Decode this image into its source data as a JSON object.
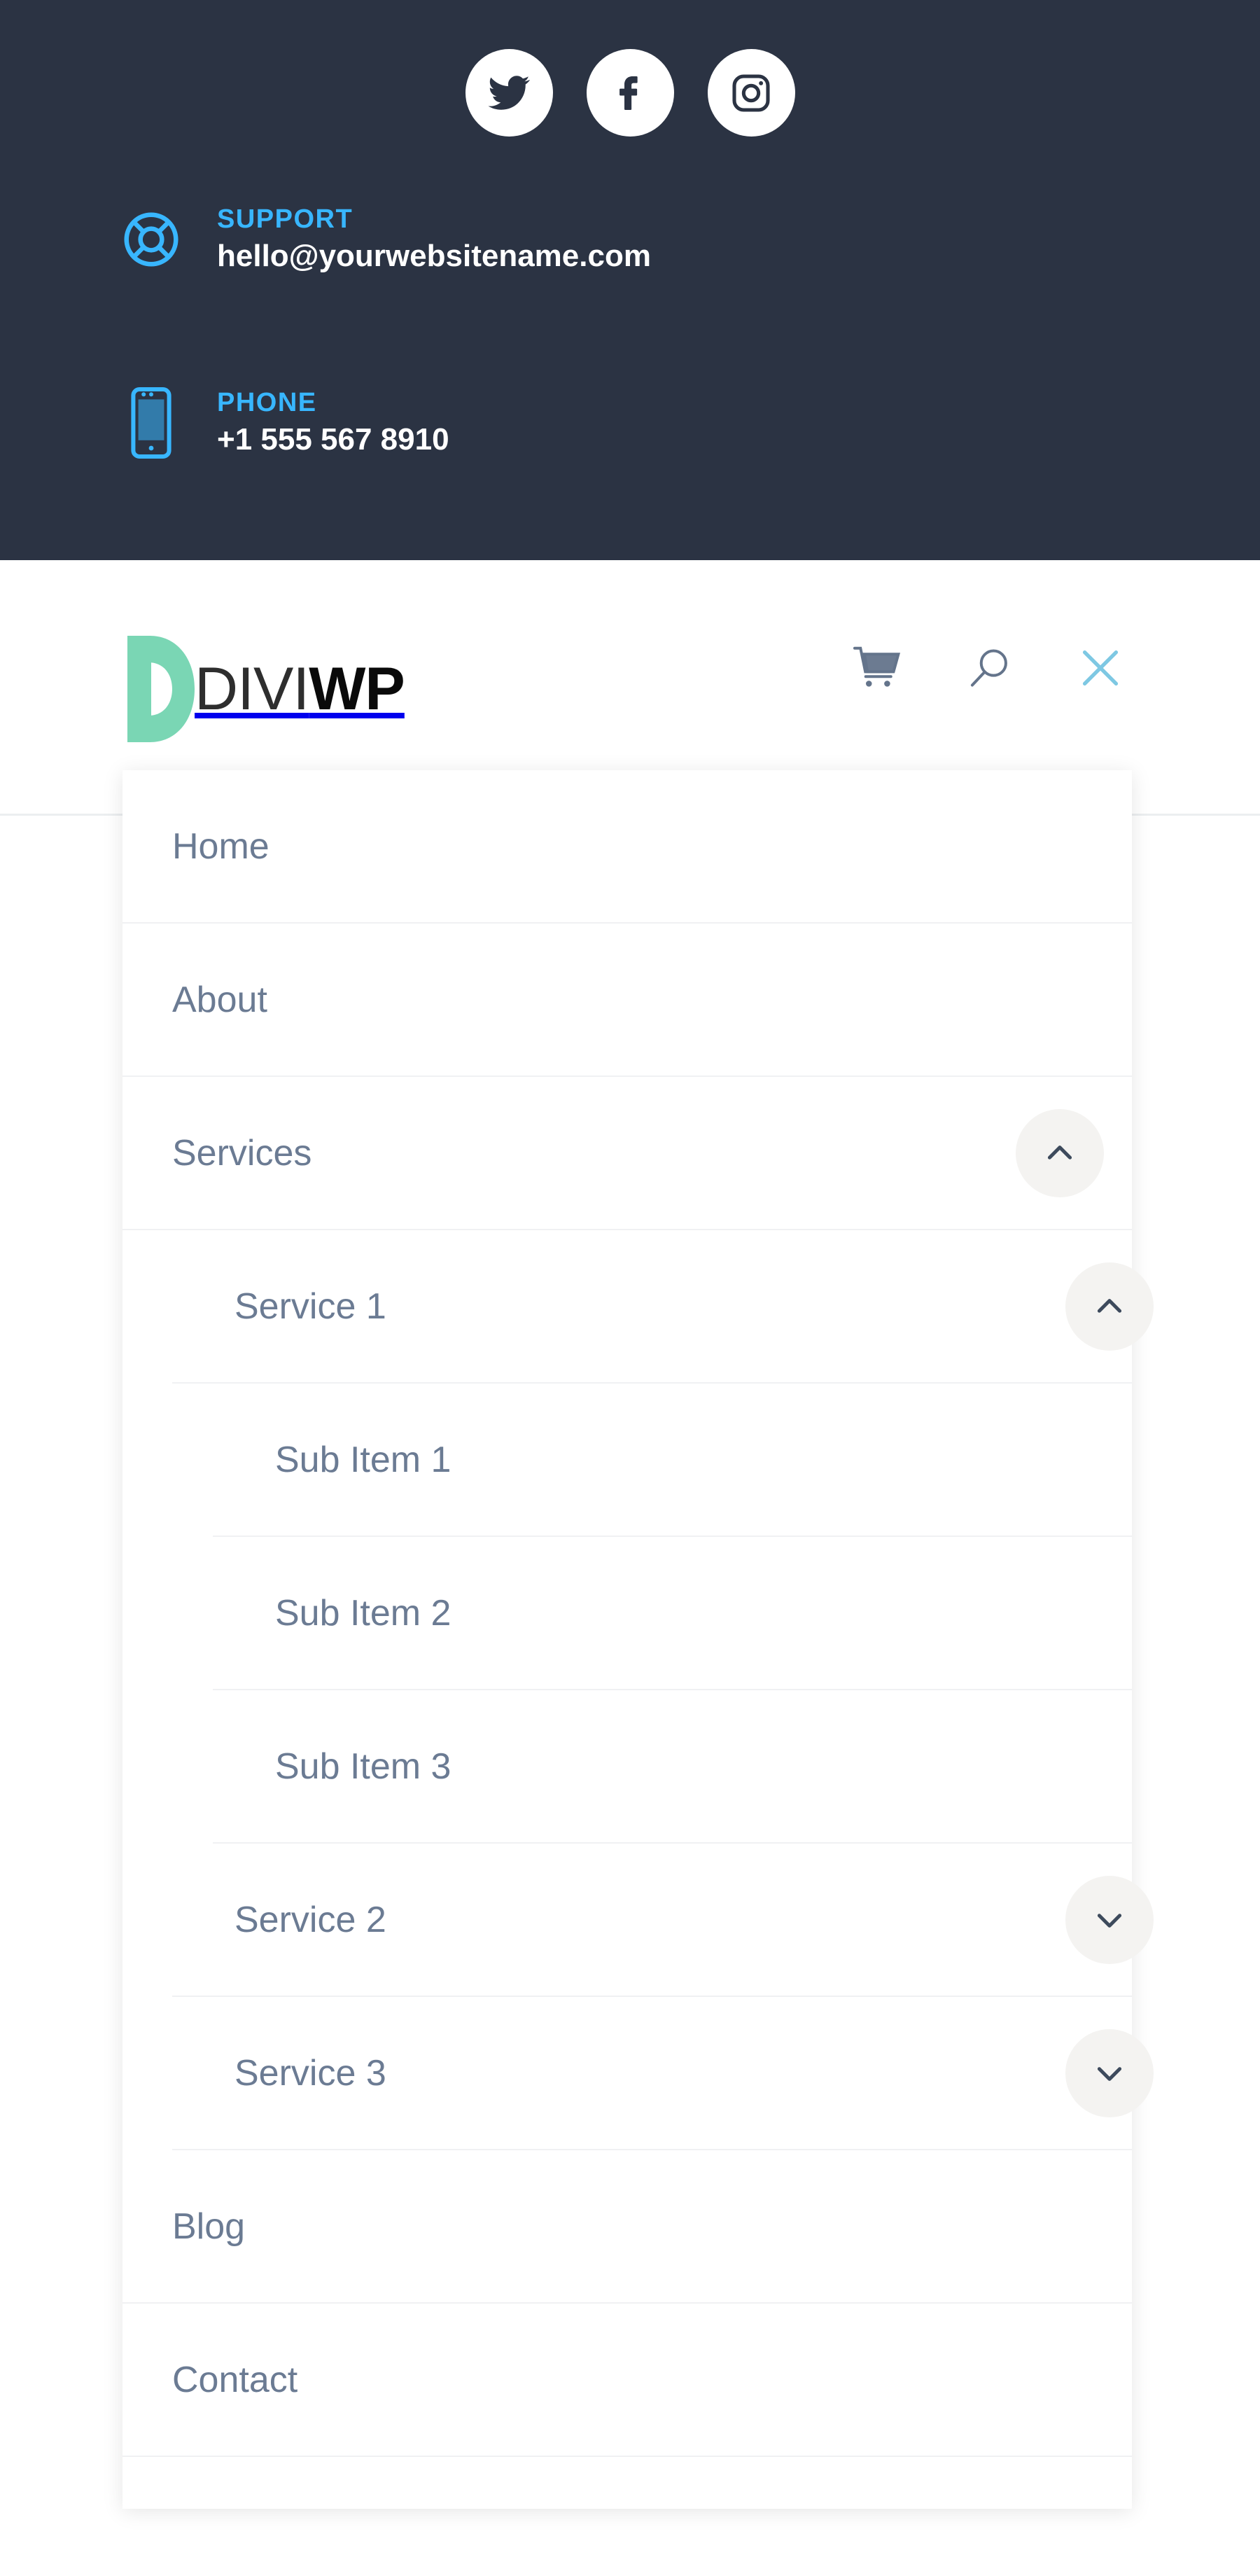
{
  "topbar": {
    "background_color": "#2b3343",
    "accent_color": "#38b6ff",
    "social": [
      {
        "name": "twitter",
        "label": "Twitter"
      },
      {
        "name": "facebook",
        "label": "Facebook"
      },
      {
        "name": "instagram",
        "label": "Instagram"
      }
    ],
    "support": {
      "icon": "lifebuoy-icon",
      "label": "SUPPORT",
      "value": "hello@yourwebsitename.com"
    },
    "phone": {
      "icon": "mobile-phone-icon",
      "label": "PHONE",
      "value": "+1 555 567 8910"
    }
  },
  "header": {
    "logo": {
      "mark_color": "#7ad6b4",
      "text_light": "DIVI",
      "text_bold": "WP"
    },
    "icons": [
      {
        "name": "cart-icon",
        "label": "Cart",
        "color": "#64748b"
      },
      {
        "name": "search-icon",
        "label": "Search",
        "color": "#64748b"
      },
      {
        "name": "close-icon",
        "label": "Close menu",
        "color": "#7ec8e3"
      }
    ]
  },
  "menu": {
    "items": [
      {
        "label": "Home",
        "level": 1,
        "toggle": "none"
      },
      {
        "label": "About",
        "level": 1,
        "toggle": "none"
      },
      {
        "label": "Services",
        "level": 1,
        "toggle": "up"
      },
      {
        "label": "Service 1",
        "level": 2,
        "toggle": "up"
      },
      {
        "label": "Sub Item 1",
        "level": 3,
        "toggle": "none"
      },
      {
        "label": "Sub Item 2",
        "level": 3,
        "toggle": "none"
      },
      {
        "label": "Sub Item 3",
        "level": 3,
        "toggle": "none"
      },
      {
        "label": "Service 2",
        "level": 2,
        "toggle": "down"
      },
      {
        "label": "Service 3",
        "level": 2,
        "toggle": "down"
      },
      {
        "label": "Blog",
        "level": 1,
        "toggle": "none"
      },
      {
        "label": "Contact",
        "level": 1,
        "toggle": "none"
      }
    ],
    "text_color": "#6b7b93",
    "divider_color": "#f0f1f3",
    "toggle_bg": "#f4f3f1"
  }
}
